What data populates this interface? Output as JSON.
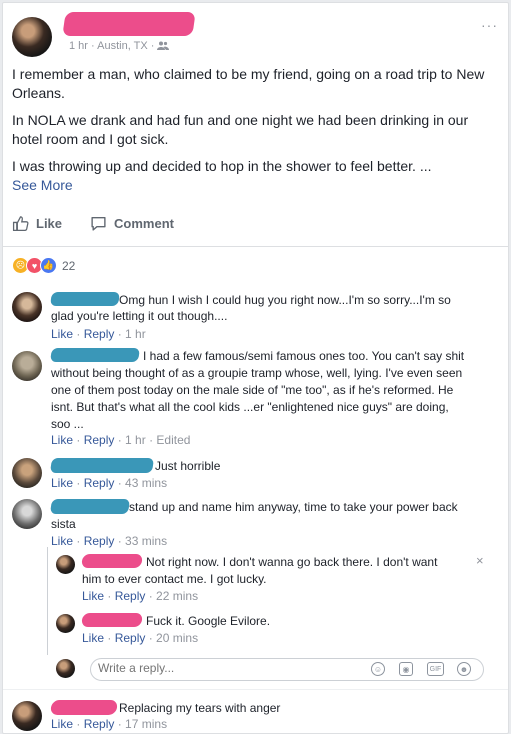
{
  "post": {
    "meta": "1 hr · Austin, TX ·",
    "paragraphs": [
      "I remember a man, who claimed to be my friend, going on a road trip to New Orleans.",
      "In NOLA we drank and had fun and one night we had been drinking in our hotel room and I got sick.",
      "I was throwing up and decided to hop in the shower to feel better. ..."
    ],
    "see_more": "See More",
    "more_icon": "···"
  },
  "actions": {
    "like": "Like",
    "comment": "Comment"
  },
  "reactions": {
    "count": "22",
    "icons": [
      "sad-icon",
      "love-icon",
      "like-icon"
    ]
  },
  "comments": [
    {
      "text": "Omg hun I wish I could hug you right now...I'm so sorry...I'm so",
      "text2": "glad you're letting it out though....",
      "like": "Like",
      "reply": "Reply",
      "time": "1 hr"
    },
    {
      "text": "I had a few famous/semi famous ones too. You can't say shit",
      "lines": [
        "without being thought of as a groupie tramp whose, well, lying. I've even seen",
        "one of them post today on the male side of \"me too\", as if he's reformed. He",
        "isnt. But that's what all the cool kids ...er \"enlightened nice guys\" are doing,",
        "soo ..."
      ],
      "like": "Like",
      "reply": "Reply",
      "time": "1 hr",
      "edited": "Edited"
    },
    {
      "text": "Just horrible",
      "like": "Like",
      "reply": "Reply",
      "time": "43 mins"
    },
    {
      "text": "stand up and name him anyway, time to take your power back",
      "text2": "sista",
      "like": "Like",
      "reply": "Reply",
      "time": "33 mins"
    },
    {
      "text": "Not right now. I don't wanna go back there. I don't want",
      "text2": "him to ever contact me. I got lucky.",
      "like": "Like",
      "reply": "Reply",
      "time": "22 mins"
    },
    {
      "text": "Fuck it. Google Evilore.",
      "like": "Like",
      "reply": "Reply",
      "time": "20 mins"
    },
    {
      "text": "Replacing my tears with anger",
      "like": "Like",
      "reply": "Reply",
      "time": "17 mins"
    }
  ],
  "reply_box": {
    "placeholder": "Write a reply...",
    "icons": [
      "emoji-icon",
      "camera-icon",
      "gif-icon",
      "sticker-icon"
    ]
  },
  "close_glyph": "×",
  "colors": {
    "link": "#365899",
    "meta": "#90949c",
    "redact_pink": "#ec4d8b",
    "redact_blue": "#3a97b8"
  }
}
